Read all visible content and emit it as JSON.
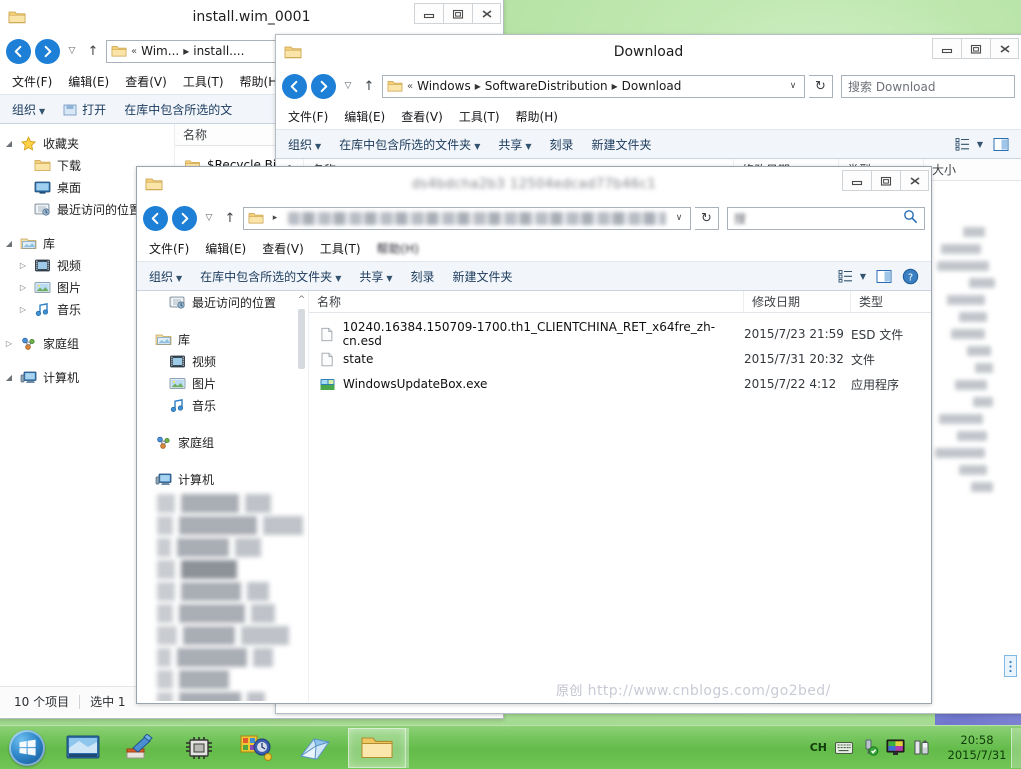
{
  "desktop": {
    "wallpaper_color": "#a7dc93",
    "watermark_cn": "原创",
    "watermark_url": "http://www.cnblogs.com/go2bed/"
  },
  "window1": {
    "title": "install.wim_0001",
    "icon": "folder-icon",
    "controls": {
      "minimize": "minimize-icon",
      "maximize": "maximize-icon",
      "close": "close-icon"
    },
    "breadcrumb": [
      "Wim...",
      "install...."
    ],
    "breadcrumb_prefix": "«",
    "menu": [
      "文件(F)",
      "编辑(E)",
      "查看(V)",
      "工具(T)",
      "帮助(H)"
    ],
    "toolbar": {
      "organize": "组织",
      "open": "打开",
      "include_in_library": "在库中包含所选的文"
    },
    "column_name": "名称",
    "nav": [
      {
        "label": "收藏夹",
        "icon": "star-icon",
        "twisty": "expanded",
        "indent": 0
      },
      {
        "label": "下载",
        "icon": "folder-icon",
        "twisty": "",
        "indent": 1
      },
      {
        "label": "桌面",
        "icon": "desktop-icon",
        "twisty": "",
        "indent": 1
      },
      {
        "label": "最近访问的位置",
        "icon": "recent-icon",
        "twisty": "",
        "indent": 1
      },
      {
        "label": "库",
        "icon": "library-icon",
        "twisty": "expanded",
        "indent": 0
      },
      {
        "label": "视频",
        "icon": "video-icon",
        "twisty": "collapsed",
        "indent": 1
      },
      {
        "label": "图片",
        "icon": "picture-icon",
        "twisty": "collapsed",
        "indent": 1
      },
      {
        "label": "音乐",
        "icon": "music-icon",
        "twisty": "collapsed",
        "indent": 1
      },
      {
        "label": "家庭组",
        "icon": "homegroup-icon",
        "twisty": "collapsed",
        "indent": 0
      },
      {
        "label": "计算机",
        "icon": "computer-icon",
        "twisty": "expanded",
        "indent": 0
      }
    ],
    "files": [
      {
        "name": "$Recycle.Bi",
        "icon": "folder-icon"
      }
    ],
    "status": {
      "items": "10 个项目",
      "selected": "选中 1"
    }
  },
  "window2": {
    "title": "Download",
    "icon": "folder-icon",
    "controls": {
      "minimize": "minimize-icon",
      "maximize": "maximize-icon",
      "close": "close-icon"
    },
    "breadcrumb_prefix": "«",
    "breadcrumb": [
      "Windows",
      "SoftwareDistribution",
      "Download"
    ],
    "search_placeholder": "搜索 Download",
    "menu": [
      "文件(F)",
      "编辑(E)",
      "查看(V)",
      "工具(T)",
      "帮助(H)"
    ],
    "toolbar": {
      "organize": "组织",
      "include_in_library": "在库中包含所选的文件夹",
      "share": "共享",
      "burn": "刻录",
      "new_folder": "新建文件夹"
    },
    "columns": [
      "名称",
      "修改日期",
      "类型",
      "大小"
    ]
  },
  "window3": {
    "title_blurred": true,
    "icon": "folder-icon",
    "controls": {
      "minimize": "minimize-icon",
      "maximize": "maximize-icon",
      "close": "close-icon"
    },
    "address_blurred": true,
    "menu": [
      "文件(F)",
      "编辑(E)",
      "查看(V)",
      "工具(T)"
    ],
    "menu_blurred_last": "帮助(H)",
    "toolbar": {
      "organize": "组织",
      "include_in_library": "在库中包含所选的文件夹",
      "share": "共享",
      "burn": "刻录",
      "new_folder": "新建文件夹",
      "view_icon": "view-options-icon",
      "pane_icon": "preview-pane-icon",
      "help_icon": "help-icon"
    },
    "columns": [
      "名称",
      "修改日期",
      "类型"
    ],
    "nav": [
      {
        "label": "最近访问的位置",
        "icon": "recent-icon",
        "indent": 1
      },
      {
        "label": "库",
        "icon": "library-icon",
        "indent": 0
      },
      {
        "label": "视频",
        "icon": "video-icon",
        "indent": 1
      },
      {
        "label": "图片",
        "icon": "picture-icon",
        "indent": 1
      },
      {
        "label": "音乐",
        "icon": "music-icon",
        "indent": 1
      },
      {
        "label": "家庭组",
        "icon": "homegroup-icon",
        "indent": 0
      },
      {
        "label": "计算机",
        "icon": "computer-icon",
        "indent": 0
      }
    ],
    "files": [
      {
        "name": "10240.16384.150709-1700.th1_CLIENTCHINA_RET_x64fre_zh-cn.esd",
        "date": "2015/7/23 21:59",
        "type": "ESD 文件",
        "icon": "file-icon"
      },
      {
        "name": "state",
        "date": "2015/7/31 20:32",
        "type": "文件",
        "icon": "file-icon"
      },
      {
        "name": "WindowsUpdateBox.exe",
        "date": "2015/7/22 4:12",
        "type": "应用程序",
        "icon": "app-icon"
      }
    ]
  },
  "taskbar": {
    "start": "start-orb",
    "buttons": [
      {
        "name": "taskbar-item-display",
        "icon": "monitor-icon"
      },
      {
        "name": "taskbar-item-tool",
        "icon": "paint-tool-icon"
      },
      {
        "name": "taskbar-item-chip",
        "icon": "chip-icon"
      },
      {
        "name": "taskbar-item-game",
        "icon": "game-icon"
      },
      {
        "name": "taskbar-item-notes",
        "icon": "notes-icon"
      },
      {
        "name": "taskbar-item-explorer",
        "icon": "folder-icon",
        "active": true
      }
    ],
    "tray": [
      {
        "name": "tray-ime",
        "label": "CH"
      },
      {
        "name": "tray-keyboard",
        "icon": "keyboard-icon"
      },
      {
        "name": "tray-usb",
        "icon": "usb-safe-remove-icon"
      },
      {
        "name": "tray-display",
        "icon": "color-display-icon"
      },
      {
        "name": "tray-battery",
        "icon": "battery-icon"
      }
    ],
    "clock_time": "20:58",
    "clock_date": "2015/7/31"
  }
}
